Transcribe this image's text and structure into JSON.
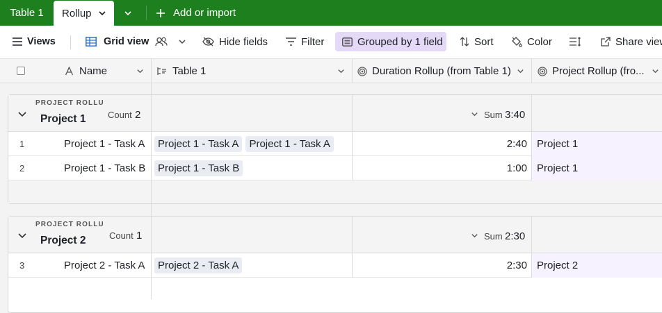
{
  "tabs": [
    {
      "label": "Table 1"
    },
    {
      "label": "Rollup"
    }
  ],
  "add_import_label": "Add or import",
  "toolbar": {
    "views": "Views",
    "grid_view": "Grid view",
    "hide_fields": "Hide fields",
    "filter": "Filter",
    "grouped": "Grouped by 1 field",
    "sort": "Sort",
    "color": "Color",
    "share": "Share view"
  },
  "columns": {
    "name": "Name",
    "table1": "Table 1",
    "duration": "Duration Rollup (from Table 1)",
    "project": "Project Rollup (fro..."
  },
  "groups": [
    {
      "field_label": "PROJECT ROLLUP",
      "title": "Project 1",
      "count_label": "Count",
      "count": "2",
      "sum_label": "Sum",
      "sum": "3:40",
      "rows": [
        {
          "num": "1",
          "name": "Project 1 - Task A",
          "links": [
            "Project 1 - Task A",
            "Project 1 - Task A"
          ],
          "duration": "2:40",
          "project": "Project 1"
        },
        {
          "num": "2",
          "name": "Project 1 - Task B",
          "links": [
            "Project 1 - Task B"
          ],
          "duration": "1:00",
          "project": "Project 1"
        }
      ]
    },
    {
      "field_label": "PROJECT ROLLUP",
      "title": "Project 2",
      "count_label": "Count",
      "count": "1",
      "sum_label": "Sum",
      "sum": "2:30",
      "rows": [
        {
          "num": "3",
          "name": "Project 2 - Task A",
          "links": [
            "Project 2 - Task A"
          ],
          "duration": "2:30",
          "project": "Project 2"
        }
      ]
    }
  ],
  "colors": {
    "tabbar": "#1e7f1e",
    "grouped_bg": "#e4d9f7",
    "rollup_cell": "#f6f2ff"
  }
}
